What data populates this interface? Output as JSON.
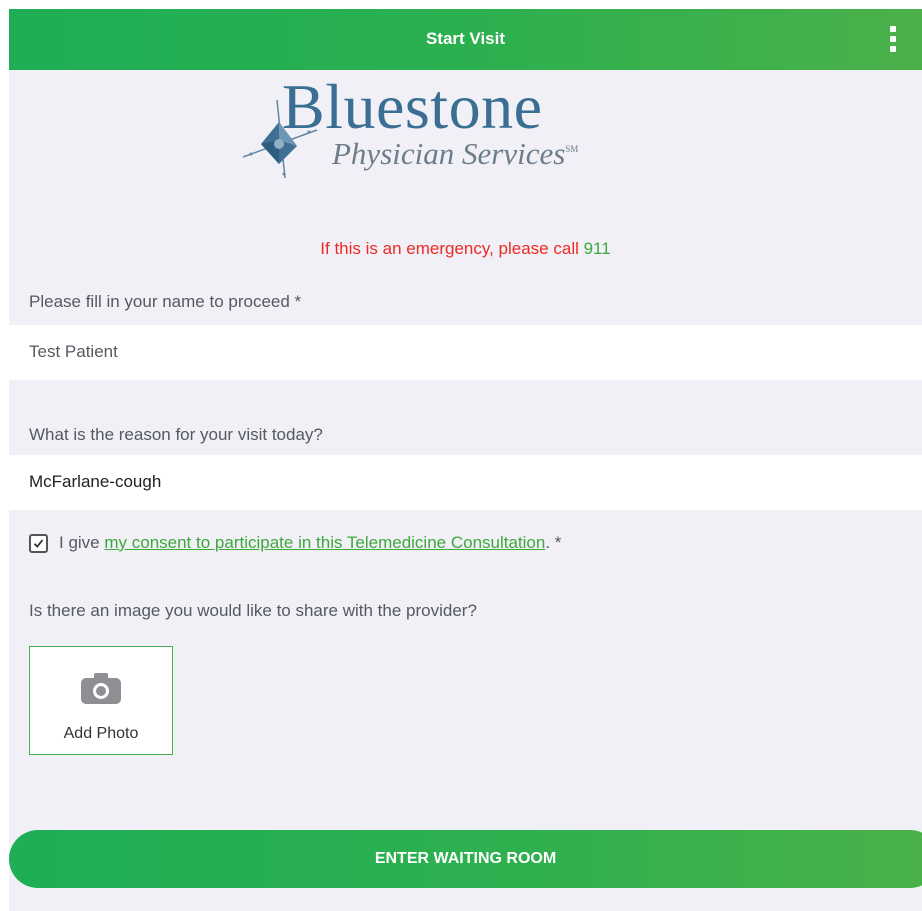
{
  "header": {
    "title": "Start Visit",
    "menu_icon": "more-vertical-icon"
  },
  "logo": {
    "name": "Bluestone",
    "tagline": "Physician Services",
    "mark": "SM"
  },
  "emergency": {
    "text": "If this is an emergency, please call ",
    "number": "911"
  },
  "name_field": {
    "label": "Please fill in your name to proceed *",
    "value": "Test Patient"
  },
  "reason_field": {
    "label": "What is the reason for your visit today?",
    "value": "McFarlane-cough"
  },
  "consent": {
    "checked": true,
    "prefix": "I give ",
    "link": "my consent to participate in this Telemedicine Consultation",
    "suffix": ". *"
  },
  "photo": {
    "question": "Is there an image you would like to share with the provider?",
    "button_label": "Add Photo",
    "icon": "camera-icon"
  },
  "enter_button": {
    "label": "ENTER WAITING ROOM"
  },
  "colors": {
    "brand_green": "#2bb04f",
    "emergency_red": "#ee2a22",
    "logo_blue": "#3a6e92",
    "background": "#f0f0f6"
  }
}
